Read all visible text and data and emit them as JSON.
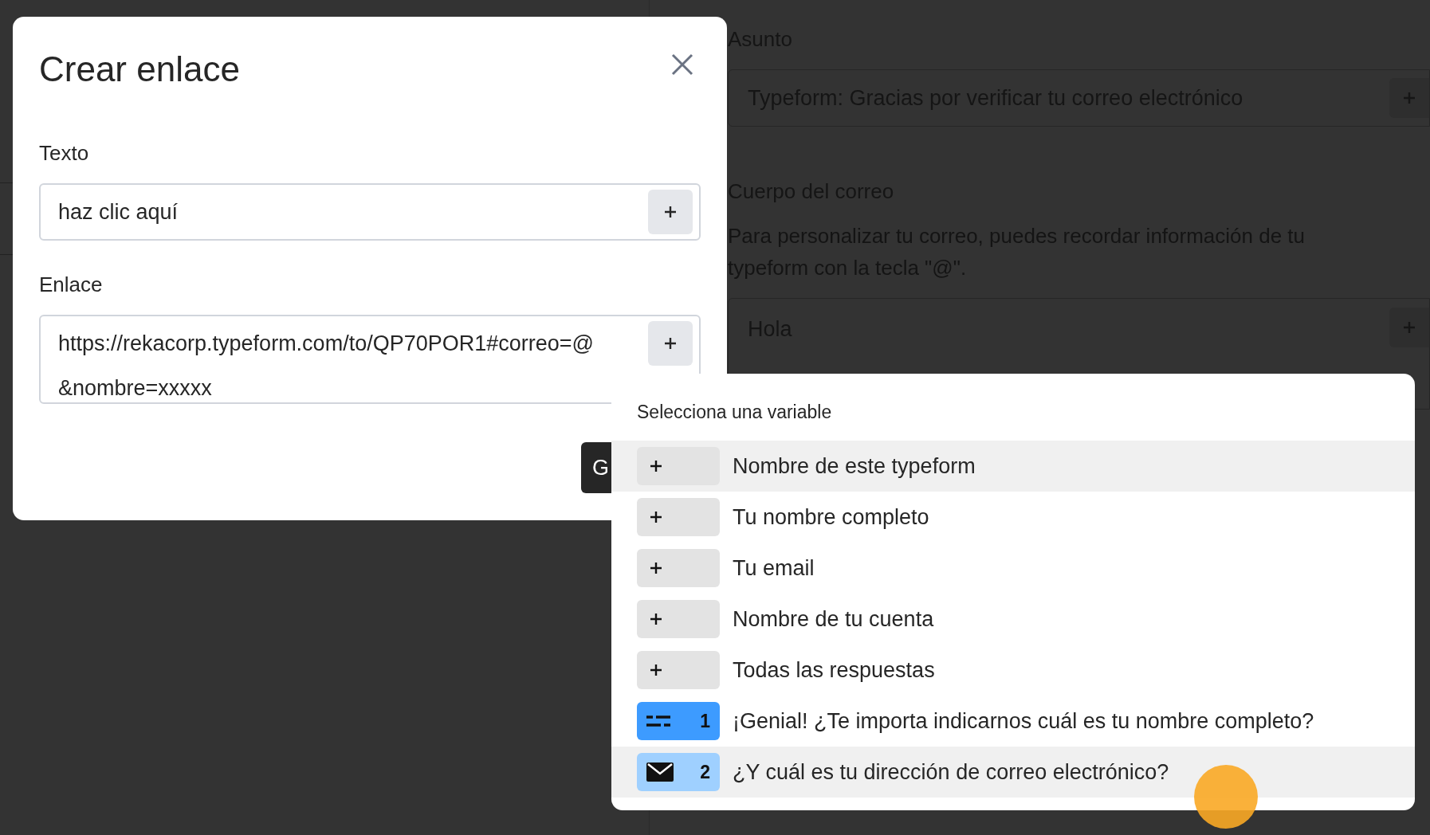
{
  "background": {
    "subject_label": "Asunto",
    "subject_value": "Typeform: Gracias por verificar tu correo electrónico",
    "body_label": "Cuerpo del correo",
    "body_help": "Para personalizar tu correo, puedes recordar información de tu typeform con la tecla \"@\".",
    "body_value": "Hola"
  },
  "dialog": {
    "title": "Crear enlace",
    "text_label": "Texto",
    "text_value": "haz clic aquí",
    "link_label": "Enlace",
    "link_value": "https://rekacorp.typeform.com/to/QP70POR1#correo=@ &nombre=xxxxx",
    "button": "G"
  },
  "variable_menu": {
    "title": "Selecciona una variable",
    "items": [
      {
        "kind": "variable",
        "label": "Nombre de este typeform",
        "highlighted": true
      },
      {
        "kind": "variable",
        "label": "Tu nombre completo",
        "highlighted": false
      },
      {
        "kind": "variable",
        "label": "Tu email",
        "highlighted": false
      },
      {
        "kind": "variable",
        "label": "Nombre de tu cuenta",
        "highlighted": false
      },
      {
        "kind": "variable",
        "label": "Todas las respuestas",
        "highlighted": false
      },
      {
        "kind": "short_text",
        "number": "1",
        "color": "#3d9bff",
        "label": "¡Genial! ¿Te importa indicarnos cuál es tu nombre completo?",
        "highlighted": false
      },
      {
        "kind": "email",
        "number": "2",
        "color": "#9fd0ff",
        "label": "¿Y cuál es tu dirección de correo electrónico?",
        "highlighted": true
      }
    ]
  }
}
